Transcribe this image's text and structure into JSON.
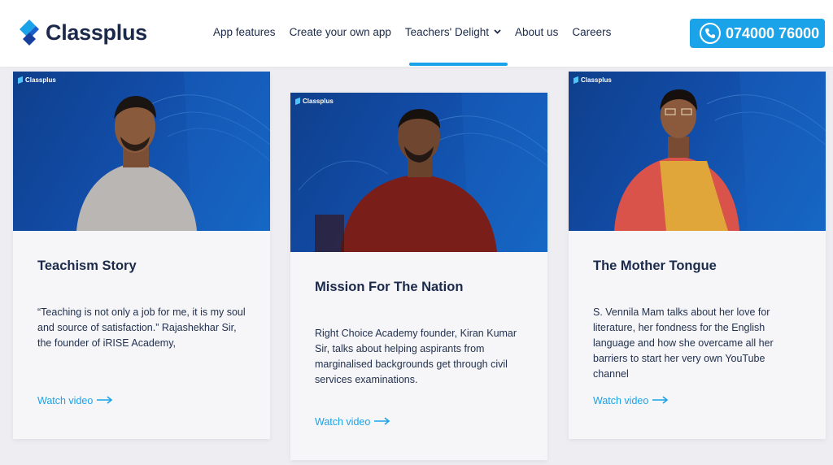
{
  "header": {
    "brand": "Classplus",
    "nav": [
      {
        "label": "App features"
      },
      {
        "label": "Create your own app"
      },
      {
        "label": "Teachers' Delight"
      },
      {
        "label": "About us"
      },
      {
        "label": "Careers"
      }
    ],
    "phone": "074000 76000"
  },
  "cards": [
    {
      "media_brand": "Classplus",
      "title": "Teachism Story",
      "description": "“Teaching is not only a job for me, it is my soul and source of satisfaction.” Rajashekhar Sir, the founder of iRISE Academy,",
      "link": "Watch video"
    },
    {
      "media_brand": "Classplus",
      "title": "Mission For The Nation",
      "description": "Right Choice Academy founder, Kiran Kumar Sir, talks about helping aspirants from marginalised backgrounds get through civil services examinations.",
      "link": "Watch video"
    },
    {
      "media_brand": "Classplus",
      "title": "The Mother Tongue",
      "description": "S. Vennila Mam talks about her love for literature, her fondness for the English language and how she overcame all her barriers to start her very own YouTube channel",
      "link": "Watch video"
    }
  ],
  "colors": {
    "accent": "#1aa3e8",
    "navy": "#1b2a4a",
    "media_blue": "#124da8"
  },
  "icons": {
    "phone": "phone-icon",
    "chevron": "chevron-down-icon",
    "arrow": "arrow-right-icon"
  }
}
